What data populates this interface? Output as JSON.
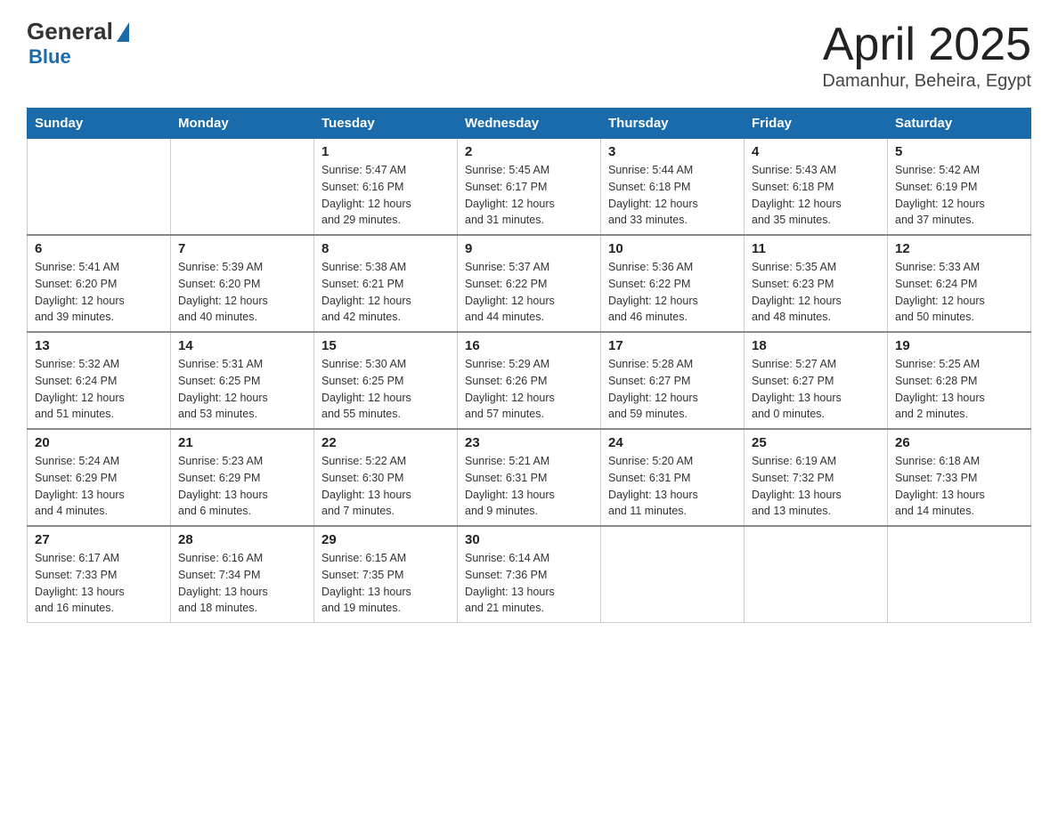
{
  "logo": {
    "general": "General",
    "blue": "Blue"
  },
  "title": "April 2025",
  "subtitle": "Damanhur, Beheira, Egypt",
  "headers": [
    "Sunday",
    "Monday",
    "Tuesday",
    "Wednesday",
    "Thursday",
    "Friday",
    "Saturday"
  ],
  "weeks": [
    [
      {
        "day": "",
        "info": ""
      },
      {
        "day": "",
        "info": ""
      },
      {
        "day": "1",
        "info": "Sunrise: 5:47 AM\nSunset: 6:16 PM\nDaylight: 12 hours\nand 29 minutes."
      },
      {
        "day": "2",
        "info": "Sunrise: 5:45 AM\nSunset: 6:17 PM\nDaylight: 12 hours\nand 31 minutes."
      },
      {
        "day": "3",
        "info": "Sunrise: 5:44 AM\nSunset: 6:18 PM\nDaylight: 12 hours\nand 33 minutes."
      },
      {
        "day": "4",
        "info": "Sunrise: 5:43 AM\nSunset: 6:18 PM\nDaylight: 12 hours\nand 35 minutes."
      },
      {
        "day": "5",
        "info": "Sunrise: 5:42 AM\nSunset: 6:19 PM\nDaylight: 12 hours\nand 37 minutes."
      }
    ],
    [
      {
        "day": "6",
        "info": "Sunrise: 5:41 AM\nSunset: 6:20 PM\nDaylight: 12 hours\nand 39 minutes."
      },
      {
        "day": "7",
        "info": "Sunrise: 5:39 AM\nSunset: 6:20 PM\nDaylight: 12 hours\nand 40 minutes."
      },
      {
        "day": "8",
        "info": "Sunrise: 5:38 AM\nSunset: 6:21 PM\nDaylight: 12 hours\nand 42 minutes."
      },
      {
        "day": "9",
        "info": "Sunrise: 5:37 AM\nSunset: 6:22 PM\nDaylight: 12 hours\nand 44 minutes."
      },
      {
        "day": "10",
        "info": "Sunrise: 5:36 AM\nSunset: 6:22 PM\nDaylight: 12 hours\nand 46 minutes."
      },
      {
        "day": "11",
        "info": "Sunrise: 5:35 AM\nSunset: 6:23 PM\nDaylight: 12 hours\nand 48 minutes."
      },
      {
        "day": "12",
        "info": "Sunrise: 5:33 AM\nSunset: 6:24 PM\nDaylight: 12 hours\nand 50 minutes."
      }
    ],
    [
      {
        "day": "13",
        "info": "Sunrise: 5:32 AM\nSunset: 6:24 PM\nDaylight: 12 hours\nand 51 minutes."
      },
      {
        "day": "14",
        "info": "Sunrise: 5:31 AM\nSunset: 6:25 PM\nDaylight: 12 hours\nand 53 minutes."
      },
      {
        "day": "15",
        "info": "Sunrise: 5:30 AM\nSunset: 6:25 PM\nDaylight: 12 hours\nand 55 minutes."
      },
      {
        "day": "16",
        "info": "Sunrise: 5:29 AM\nSunset: 6:26 PM\nDaylight: 12 hours\nand 57 minutes."
      },
      {
        "day": "17",
        "info": "Sunrise: 5:28 AM\nSunset: 6:27 PM\nDaylight: 12 hours\nand 59 minutes."
      },
      {
        "day": "18",
        "info": "Sunrise: 5:27 AM\nSunset: 6:27 PM\nDaylight: 13 hours\nand 0 minutes."
      },
      {
        "day": "19",
        "info": "Sunrise: 5:25 AM\nSunset: 6:28 PM\nDaylight: 13 hours\nand 2 minutes."
      }
    ],
    [
      {
        "day": "20",
        "info": "Sunrise: 5:24 AM\nSunset: 6:29 PM\nDaylight: 13 hours\nand 4 minutes."
      },
      {
        "day": "21",
        "info": "Sunrise: 5:23 AM\nSunset: 6:29 PM\nDaylight: 13 hours\nand 6 minutes."
      },
      {
        "day": "22",
        "info": "Sunrise: 5:22 AM\nSunset: 6:30 PM\nDaylight: 13 hours\nand 7 minutes."
      },
      {
        "day": "23",
        "info": "Sunrise: 5:21 AM\nSunset: 6:31 PM\nDaylight: 13 hours\nand 9 minutes."
      },
      {
        "day": "24",
        "info": "Sunrise: 5:20 AM\nSunset: 6:31 PM\nDaylight: 13 hours\nand 11 minutes."
      },
      {
        "day": "25",
        "info": "Sunrise: 6:19 AM\nSunset: 7:32 PM\nDaylight: 13 hours\nand 13 minutes."
      },
      {
        "day": "26",
        "info": "Sunrise: 6:18 AM\nSunset: 7:33 PM\nDaylight: 13 hours\nand 14 minutes."
      }
    ],
    [
      {
        "day": "27",
        "info": "Sunrise: 6:17 AM\nSunset: 7:33 PM\nDaylight: 13 hours\nand 16 minutes."
      },
      {
        "day": "28",
        "info": "Sunrise: 6:16 AM\nSunset: 7:34 PM\nDaylight: 13 hours\nand 18 minutes."
      },
      {
        "day": "29",
        "info": "Sunrise: 6:15 AM\nSunset: 7:35 PM\nDaylight: 13 hours\nand 19 minutes."
      },
      {
        "day": "30",
        "info": "Sunrise: 6:14 AM\nSunset: 7:36 PM\nDaylight: 13 hours\nand 21 minutes."
      },
      {
        "day": "",
        "info": ""
      },
      {
        "day": "",
        "info": ""
      },
      {
        "day": "",
        "info": ""
      }
    ]
  ]
}
